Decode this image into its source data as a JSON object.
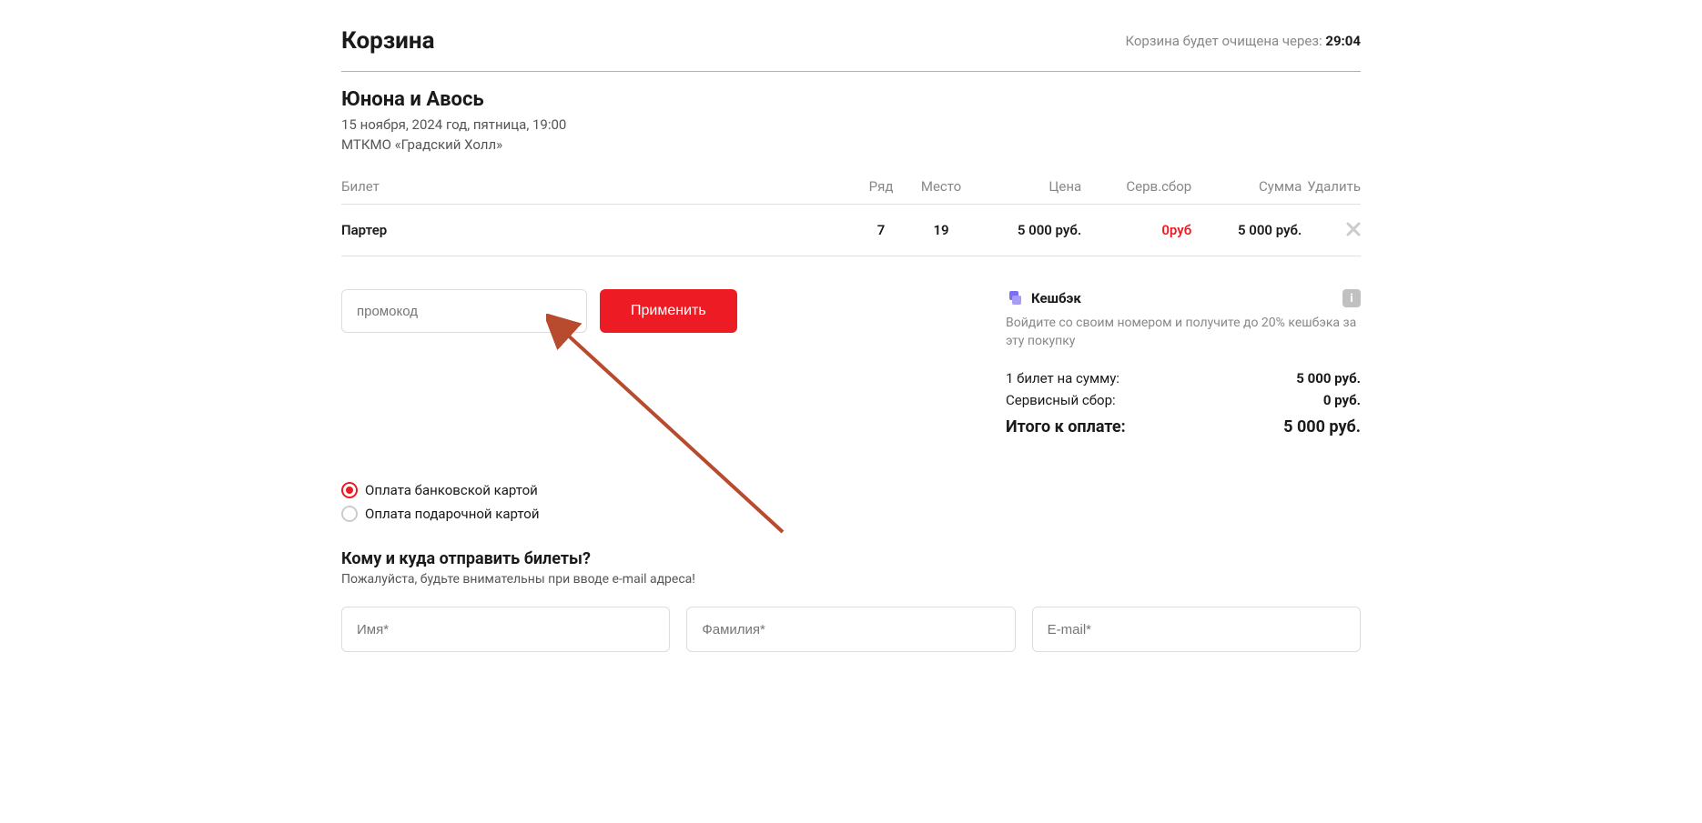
{
  "header": {
    "title": "Корзина",
    "timer_label": "Корзина будет очищена через:",
    "timer_value": "29:04"
  },
  "event": {
    "title": "Юнона и Авось",
    "date": "15 ноября, 2024 год, пятница, 19:00",
    "venue": "МТКМО «Градский Холл»"
  },
  "table": {
    "headers": {
      "ticket": "Билет",
      "row": "Ряд",
      "seat": "Место",
      "price": "Цена",
      "fee": "Серв.сбор",
      "sum": "Сумма",
      "delete": "Удалить"
    },
    "rows": [
      {
        "ticket": "Партер",
        "row": "7",
        "seat": "19",
        "price": "5 000 руб.",
        "fee": "0руб",
        "sum": "5 000 руб."
      }
    ]
  },
  "promo": {
    "placeholder": "промокод",
    "apply_label": "Применить"
  },
  "cashback": {
    "label": "Кешбэк",
    "desc": "Войдите со своим номером и получите до 20% кешбэка за эту покупку"
  },
  "summary": {
    "tickets_label": "1 билет на сумму:",
    "tickets_value": "5 000 руб.",
    "fee_label": "Сервисный сбор:",
    "fee_value": "0 руб.",
    "total_label": "Итого к оплате:",
    "total_value": "5 000 руб."
  },
  "payment": {
    "card": "Оплата банковской картой",
    "gift": "Оплата подарочной картой"
  },
  "delivery": {
    "title": "Кому и куда отправить билеты?",
    "subtitle": "Пожалуйста, будьте внимательны при вводе e-mail адреса!",
    "name_placeholder": "Имя*",
    "surname_placeholder": "Фамилия*",
    "email_placeholder": "E-mail*"
  }
}
